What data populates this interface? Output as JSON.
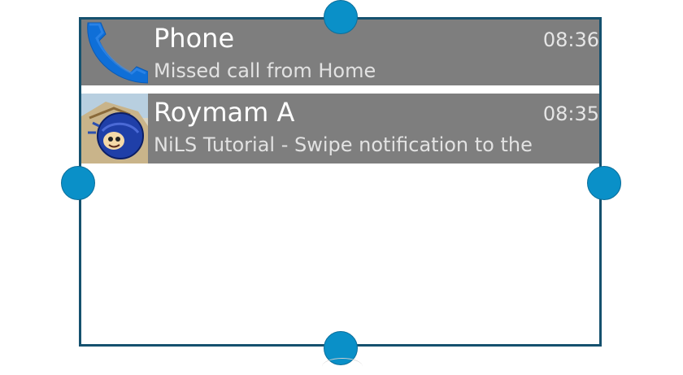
{
  "notifications": [
    {
      "app": "Phone",
      "time": "08:36",
      "text": "Missed call from Home",
      "icon": "phone-handset-icon"
    },
    {
      "app": "Roymam A",
      "time": "08:35",
      "text": "NiLS Tutorial - Swipe notification to the",
      "icon": "avatar-cartoon-icon"
    }
  ],
  "colors": {
    "card_background": "#7e7e7e",
    "frame_border": "#15516e",
    "resize_handle": "#0a90c8",
    "phone_icon_blue": "#0f6fd8"
  }
}
